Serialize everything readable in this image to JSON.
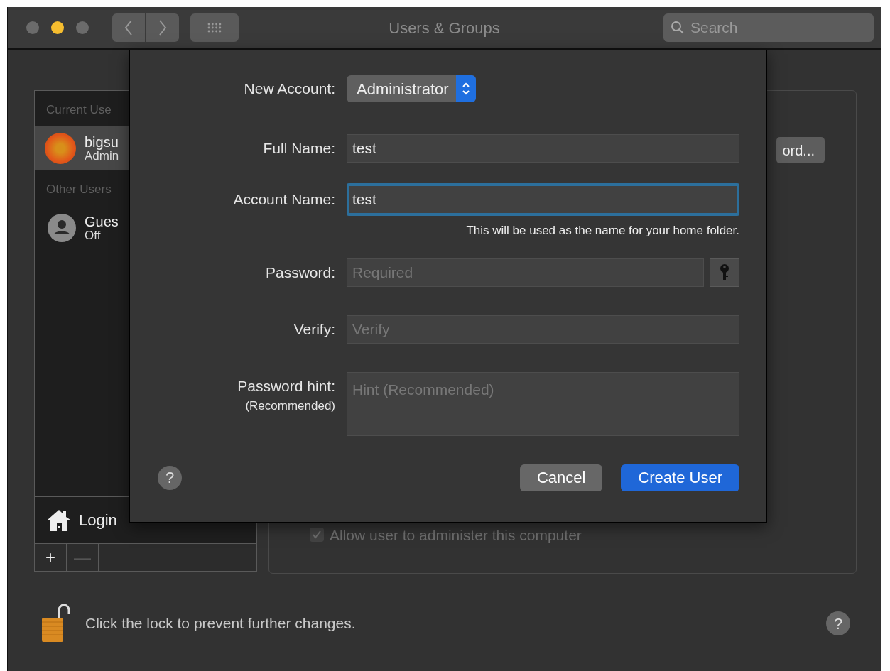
{
  "window": {
    "title": "Users & Groups",
    "traffic_lights": [
      {
        "color": "#6b6b6b"
      },
      {
        "color": "#f5bd2f"
      },
      {
        "color": "#6b6b6b"
      }
    ],
    "search": {
      "placeholder": "Search"
    }
  },
  "sidebar": {
    "sections": [
      {
        "header": "Current Use",
        "users": [
          {
            "name": "bigsu",
            "role": "Admin",
            "kind": "photo",
            "selected": true
          }
        ]
      },
      {
        "header": "Other Users",
        "users": [
          {
            "name": "Gues",
            "role": "Off",
            "kind": "generic",
            "selected": false
          }
        ]
      }
    ],
    "login_options": "Login",
    "buttons": [
      {
        "label": "+",
        "disabled": false
      },
      {
        "label": "—",
        "disabled": true
      }
    ]
  },
  "panel": {
    "button": "ord...",
    "checkbox": {
      "label": "Allow user to administer this computer",
      "checked": true,
      "disabled": true
    }
  },
  "lock": {
    "text": "Click the lock to prevent further changes.",
    "locked": false,
    "help": "?"
  },
  "sheet": {
    "new_account": {
      "label": "New Account:",
      "value": "Administrator"
    },
    "fields": [
      {
        "kind": "text",
        "label": "Full Name:",
        "value": "test",
        "focused": false
      },
      {
        "kind": "text",
        "label": "Account Name:",
        "value": "test",
        "focused": true,
        "note": "This will be used as the name for your home folder."
      },
      {
        "kind": "password",
        "label": "Password:",
        "placeholder": "Required",
        "focused": false
      },
      {
        "kind": "text",
        "label": "Verify:",
        "placeholder": "Verify",
        "focused": false
      },
      {
        "kind": "textarea",
        "label": "Password hint:",
        "sublabel": "(Recommended)",
        "placeholder": "Hint (Recommended)",
        "focused": false
      }
    ],
    "help": "?",
    "buttons": [
      {
        "label": "Cancel",
        "kind": "secondary"
      },
      {
        "label": "Create User",
        "kind": "primary"
      }
    ]
  }
}
